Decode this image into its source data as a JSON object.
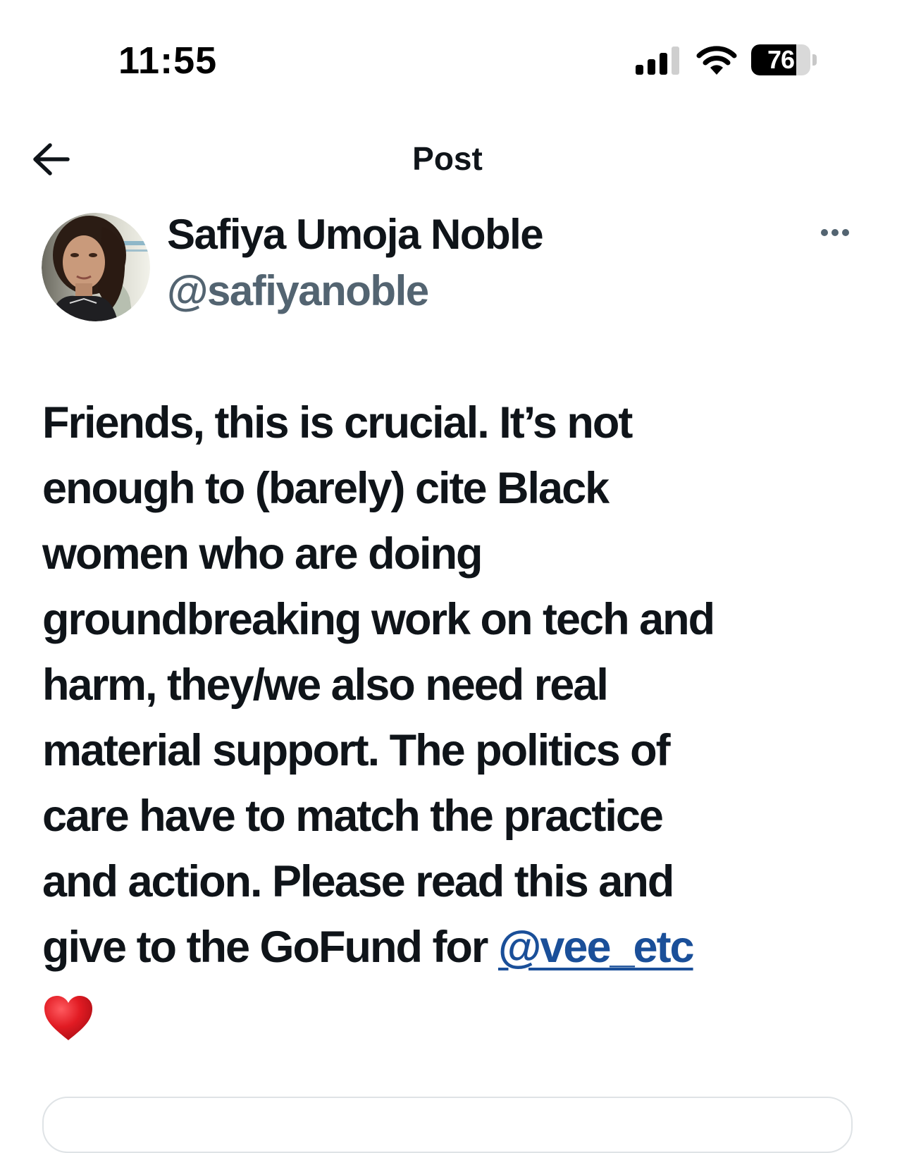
{
  "status_bar": {
    "time": "11:55",
    "battery_level": "76",
    "battery_fraction": 0.76,
    "signal_bars_active": 3,
    "signal_bars_total": 4
  },
  "header": {
    "title": "Post",
    "back_icon": "arrow-left-icon"
  },
  "author": {
    "name": "Safiya Umoja Noble",
    "handle": "@safiyanoble",
    "more_icon": "more-horizontal-icon"
  },
  "post": {
    "lines": [
      "Friends, this is crucial. It’s not",
      "enough to (barely) cite Black",
      "women who are doing",
      "groundbreaking work on tech and",
      "harm, they/we also need real",
      "material support. The politics of",
      "care have to match the practice",
      "and action. Please read this and"
    ],
    "last_line_prefix": "give to the GoFund for ",
    "mention": "@vee_etc",
    "emoji_icon": "red-heart-icon"
  },
  "colors": {
    "text": "#0f1419",
    "secondary_text": "#536471",
    "mention": "#1a4f99",
    "heart": "#d4121b"
  }
}
